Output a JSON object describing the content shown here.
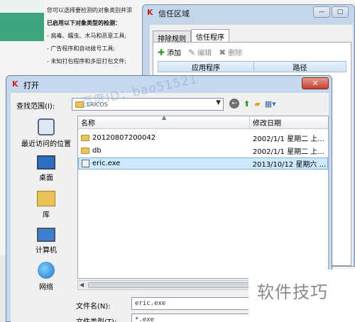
{
  "background": {
    "text_lines": [
      "您可以选择要检测的对象类别并添",
      "已启用以下对象类型的检测：",
      "- 病毒、蠕虫、木马和恶意工具;",
      "- 广告程序和自动拨号工具;",
      "- 未知打包程序和多层打包文件;"
    ]
  },
  "trust_window": {
    "title": "信任区域",
    "tabs": [
      "排除规则",
      "信任程序"
    ],
    "active_tab": 1,
    "toolbar": {
      "add": "添加",
      "edit": "编辑",
      "delete": "删除"
    },
    "list_columns": [
      "应用程序",
      "路径"
    ],
    "controls": {
      "minimize": "—",
      "maximize": "□"
    }
  },
  "open_dialog": {
    "title": "打开",
    "close": "✕",
    "look_in_label": "查找范围(I):",
    "look_in_value": "ERICOS",
    "places": [
      "最近访问的位置",
      "桌面",
      "库",
      "计算机",
      "网络"
    ],
    "columns": {
      "name": "名称",
      "date": "修改日期"
    },
    "files": [
      {
        "name": "20120807200042",
        "date": "2002/1/1 星期二 上...",
        "type": "folder"
      },
      {
        "name": "db",
        "date": "2002/1/1 星期二 上...",
        "type": "folder"
      },
      {
        "name": "eric.exe",
        "date": "2013/10/12 星期六 ...",
        "type": "exe",
        "selected": true
      }
    ],
    "file_name_label": "文件名(N):",
    "file_name_value": "eric.exe",
    "file_type_label": "文件类型(T):",
    "file_type_value": "*.exe"
  },
  "watermark": "百度ID：bao51521",
  "brand": "软件技巧",
  "colors": {
    "accent_green": "#3fa57c",
    "window_frame": "#c5d8ee",
    "selection": "#cde8ff",
    "close_red": "#c4402c"
  }
}
